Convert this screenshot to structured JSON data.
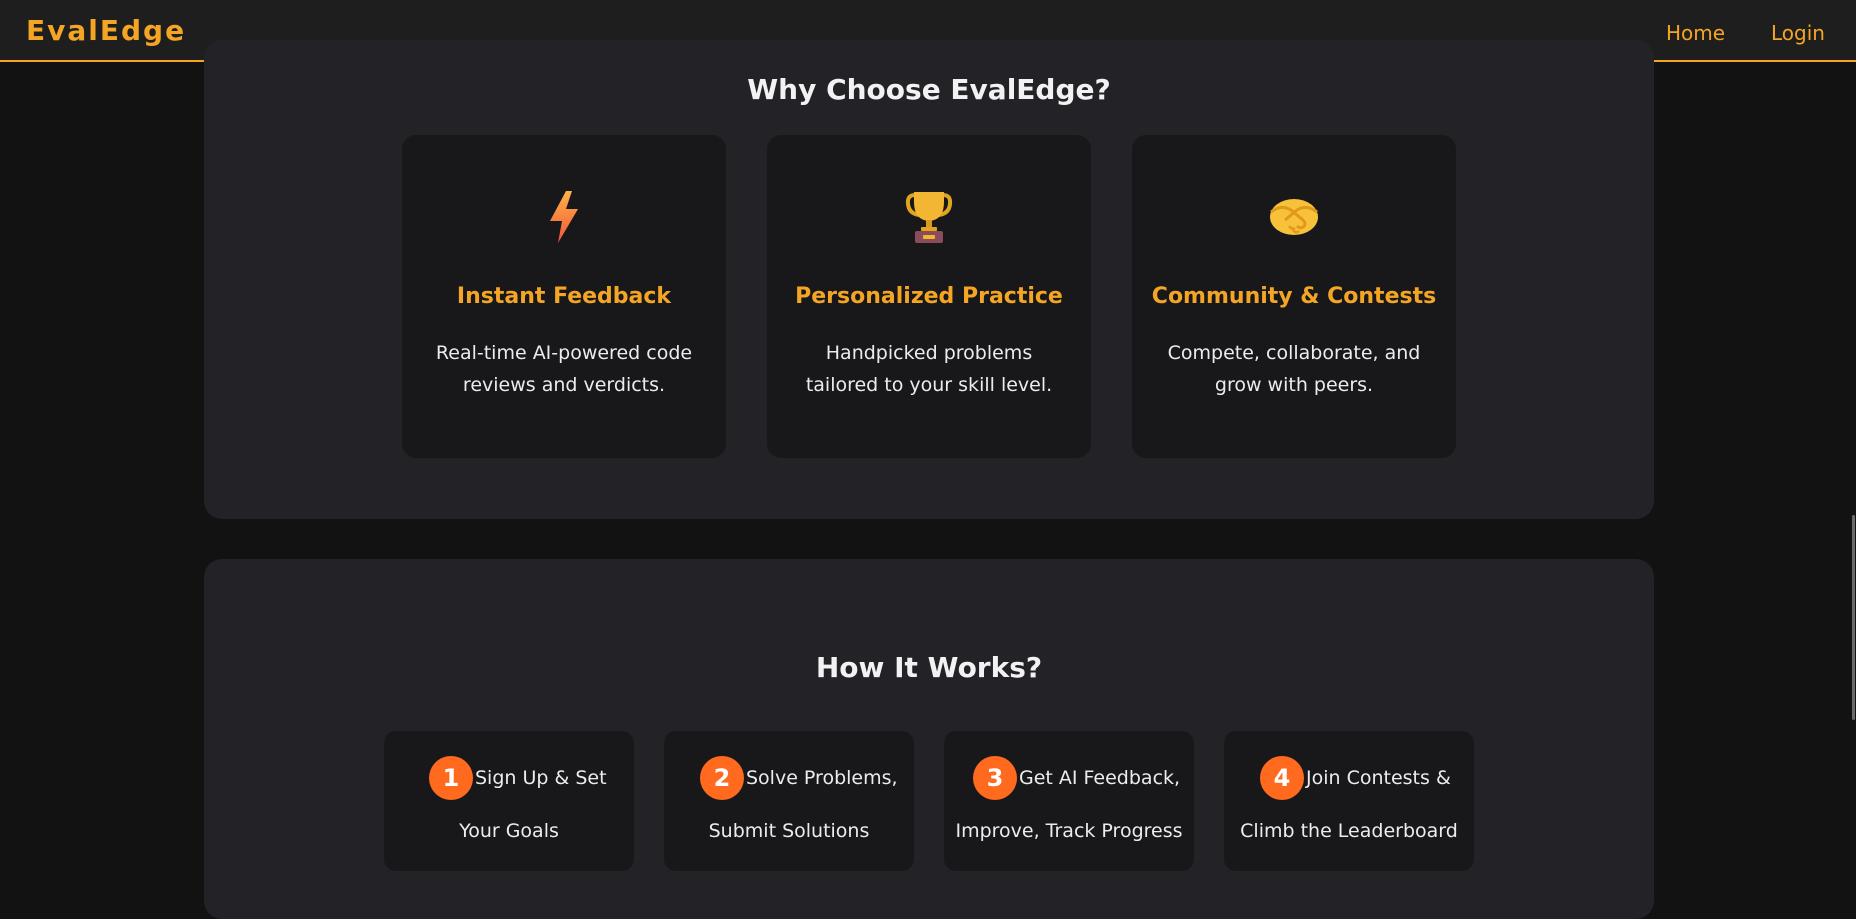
{
  "nav": {
    "brand": "EvalEdge",
    "links": [
      "Home",
      "Login"
    ]
  },
  "why": {
    "title": "Why Choose EvalEdge?",
    "features": [
      {
        "icon": "lightning-icon",
        "title": "Instant Feedback",
        "desc": "Real-time AI-powered code reviews and verdicts."
      },
      {
        "icon": "trophy-icon",
        "title": "Personalized Practice",
        "desc": "Handpicked problems tailored to your skill level."
      },
      {
        "icon": "handshake-icon",
        "title": "Community & Contests",
        "desc": "Compete, collaborate, and grow with peers."
      }
    ]
  },
  "how": {
    "title": "How It Works?",
    "steps": [
      {
        "num": "1",
        "line1": "Sign Up & Set",
        "line2": "Your Goals"
      },
      {
        "num": "2",
        "line1": "Solve Problems,",
        "line2": "Submit Solutions"
      },
      {
        "num": "3",
        "line1": "Get AI Feedback,",
        "line2": "Improve, Track Progress"
      },
      {
        "num": "4",
        "line1": "Join Contests &",
        "line2": "Climb the Leaderboard"
      }
    ]
  },
  "colors": {
    "accent": "#f5a524",
    "step_badge": "#ff6a1f",
    "page_bg": "#121213",
    "section_bg": "#232327",
    "card_bg": "#18181b"
  }
}
